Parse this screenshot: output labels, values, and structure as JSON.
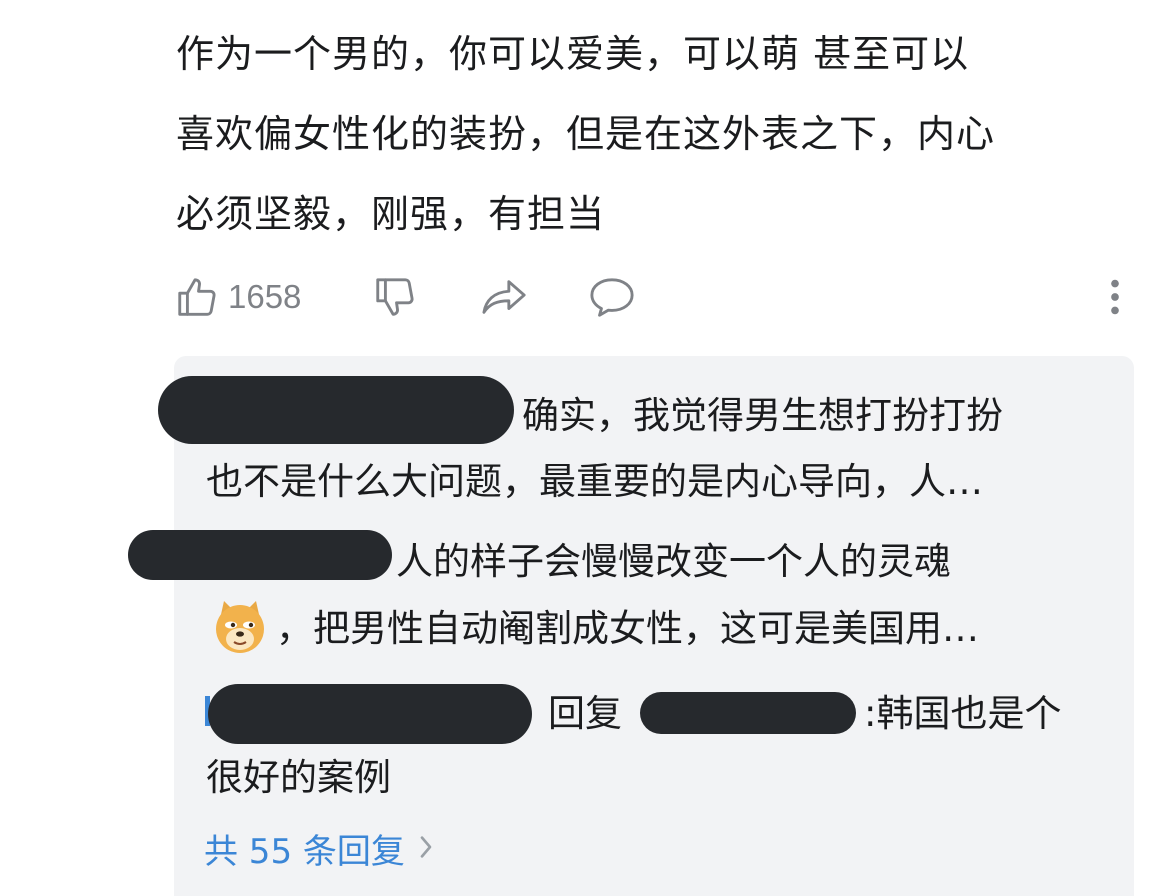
{
  "comment": {
    "lines": [
      "作为一个男的，你可以爱美，可以萌 甚至可以",
      "喜欢偏女性化的装扮，但是在这外表之下，内心",
      "必须坚毅，刚强，有担当"
    ]
  },
  "actions": {
    "like_icon": "thumbs-up-icon",
    "like_count": "1658",
    "dislike_icon": "thumbs-down-icon",
    "share_icon": "share-icon",
    "reply_icon": "comment-bubble-icon",
    "more_icon": "more-vertical-icon"
  },
  "replies": [
    {
      "username_redacted": true,
      "lines": [
        "确实，我觉得男生想打扮打扮",
        "也不是什么大问题，最重要的是内心导向，人…"
      ]
    },
    {
      "username_redacted": true,
      "emoji": "doge-emoji-icon",
      "lines": [
        "人的样子会慢慢改变一个人的灵魂",
        "，把男性自动阉割成女性，这可是美国用…"
      ]
    },
    {
      "username_redacted": true,
      "reply_word": "回复",
      "reply_to_redacted": true,
      "lines": [
        ":韩国也是个",
        "很好的案例"
      ]
    }
  ],
  "more_replies": {
    "label": "共 55 条回复",
    "chevron_icon": "chevron-right-icon"
  },
  "colors": {
    "link": "#3b86d6",
    "muted_icon": "#7f8287",
    "reply_bg": "#f2f3f5",
    "redaction": "#26292d"
  }
}
